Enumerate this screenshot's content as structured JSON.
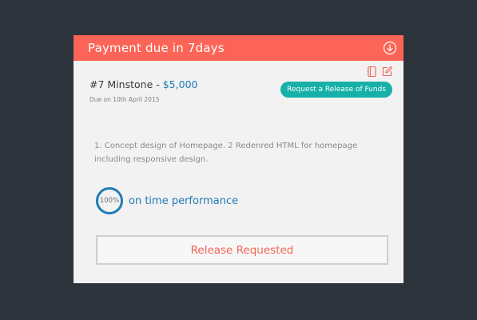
{
  "header": {
    "title": "Payment due in 7days"
  },
  "milestone": {
    "title": "#7 Minstone",
    "separator": " - ",
    "amount": "$5,000",
    "due": "Due on 10th April 2015",
    "release_button": "Request a Release of Funds"
  },
  "description": "1. Concept design of Homepage. 2 Redenred HTML  for homepage including responsive design.",
  "performance": {
    "percent_label": "100%",
    "label": "on time performance"
  },
  "status_button": "Release Requested",
  "icons": {
    "header": "download-circle-icon",
    "tools": [
      "notebook-icon",
      "edit-icon"
    ]
  },
  "colors": {
    "header": "#fb6456",
    "accent_blue": "#1f7cb5",
    "teal": "#16b0a8",
    "status_text": "#f36457",
    "background": "#2e343b"
  }
}
